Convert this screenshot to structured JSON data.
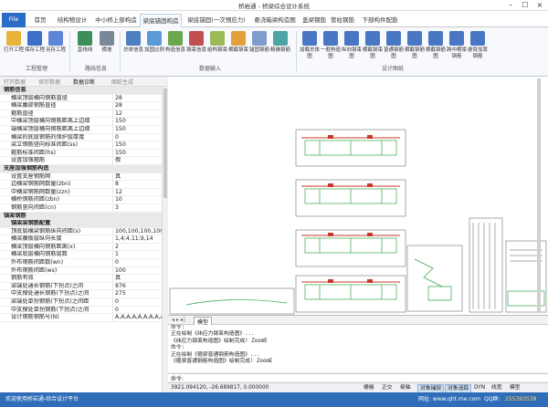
{
  "window": {
    "title": "桥岩通 - 桥梁综合设计系统"
  },
  "tabs": [
    "File",
    "首页",
    "结构物设计",
    "中小桥上部构造",
    "梁底锚固构造",
    "梁底锚固(一次预应力)",
    "悬浇箱梁构造图",
    "盖梁钢筋",
    "管柱钢筋",
    "下部构件配筋"
  ],
  "ribbon": {
    "buttons": [
      "打开工程",
      "保存工程",
      "另存工程",
      "直线线",
      "横坡",
      "总体信息",
      "加固比例",
      "构造信息",
      "钢束信息",
      "结构钢束",
      "横截钢束",
      "锚固钢筋",
      "精确钢筋",
      "加载总体图",
      "一般构造图",
      "纵向钢束图",
      "横截钢束图",
      "普通钢筋图",
      "横截钢筋图",
      "横截钢筋图",
      "跨中横梁钢筋",
      "悬臂加厚钢筋"
    ],
    "groups": [
      "工程管理",
      "路线信息",
      "数据输入",
      "设计图纸"
    ]
  },
  "panel": {
    "tools": [
      "打开数据",
      "保存数据",
      "数据诊断",
      "图纸生成"
    ]
  },
  "properties": [
    {
      "type": "cat",
      "k": "钢筋信息"
    },
    {
      "k": "横梁顶层横向钢筋直径",
      "v": "28"
    },
    {
      "k": "横梁腹部钢筋直径",
      "v": "28"
    },
    {
      "k": "箍筋直径",
      "v": "12"
    },
    {
      "k": "中横梁顶层横向钢筋距离上边缘",
      "v": "150"
    },
    {
      "k": "端横梁顶层横向钢筋距离上边缘",
      "v": "150"
    },
    {
      "k": "横梁的底层钢筋的保护层厚度",
      "v": "0"
    },
    {
      "k": "梁立钢筋竖向标准间距(ss)",
      "v": "150"
    },
    {
      "k": "箍筋标准间距(hs)",
      "v": "150"
    },
    {
      "k": "设置加强箍筋",
      "v": "假"
    },
    {
      "type": "cat",
      "k": "支座加强钢筋构造"
    },
    {
      "k": "设置支座钢筋网",
      "v": "真"
    },
    {
      "k": "边横梁钢筋网数量(zbn)",
      "v": "8"
    },
    {
      "k": "中横梁钢筋网数量(zzn)",
      "v": "12"
    },
    {
      "k": "横桥钢筋间距(zbn)",
      "v": "10"
    },
    {
      "k": "钢筋竖向间距(cn)",
      "v": "3"
    },
    {
      "type": "cat",
      "k": "锚梁钢筋"
    },
    {
      "type": "sub",
      "k": "锚梁梁钢筋配置"
    },
    {
      "k": "顶底层横梁钢筋纵向间距(s)",
      "v": "100,100,100,100,107.5,1"
    },
    {
      "k": "横梁腹板层纵向长度",
      "v": "1,4;4,11;9,14"
    },
    {
      "k": "横梁顶层横向钢筋距离(x)",
      "v": "2"
    },
    {
      "k": "横梁底层横向钢筋层数",
      "v": "1"
    },
    {
      "k": "外布钢筋间距数(wn)",
      "v": "0"
    },
    {
      "k": "外布钢筋间距(ws)",
      "v": "100"
    },
    {
      "k": "钢筋有效",
      "v": "真"
    },
    {
      "k": "梁端处通长钢筋(下拐点)之间",
      "v": "876"
    },
    {
      "k": "中支撑处通长钢筋(下拐点)之间",
      "v": "275"
    },
    {
      "k": "梁端处单拐钢筋(下拐点)之间距",
      "v": "0"
    },
    {
      "k": "中支撑处单拐钢筋(下拐点)之间",
      "v": "0"
    },
    {
      "k": "设计钢筋钢筋号(N)",
      "v": "A,A,A,A,A,A,A,A,A,A"
    }
  ],
  "model_tabs": [
    "模型"
  ],
  "command": {
    "lines": [
      "命令:",
      "  正在绘制《纬应力钢束构造图》...",
      "  《纬应力钢束构造图》绘制完成!  ZoomE",
      "命令:",
      "  正在绘制《箍梁普通钢筋构造图》...",
      "  《箍梁普通钢筋构造图》绘制完成!  ZoomE"
    ],
    "prompt": "命令:"
  },
  "status": {
    "coords": "3921.094120, -26.689817, 0.000000",
    "toggles": [
      "栅格",
      "正交",
      "极轴",
      "对象捕捉",
      "对象追踪",
      "DYN",
      "线宽",
      "模型"
    ],
    "on": [
      "对象捕捉",
      "对象追踪"
    ]
  },
  "bottom": {
    "left": "欢迎使用桥岩通-综合设计平台",
    "url": "网址: www.qht.me.com",
    "qq_label": "QQ群:",
    "qq": "255393538"
  },
  "drawing": {
    "accent": "#c7392b",
    "green": "#2fa64a",
    "line": "#333333"
  }
}
